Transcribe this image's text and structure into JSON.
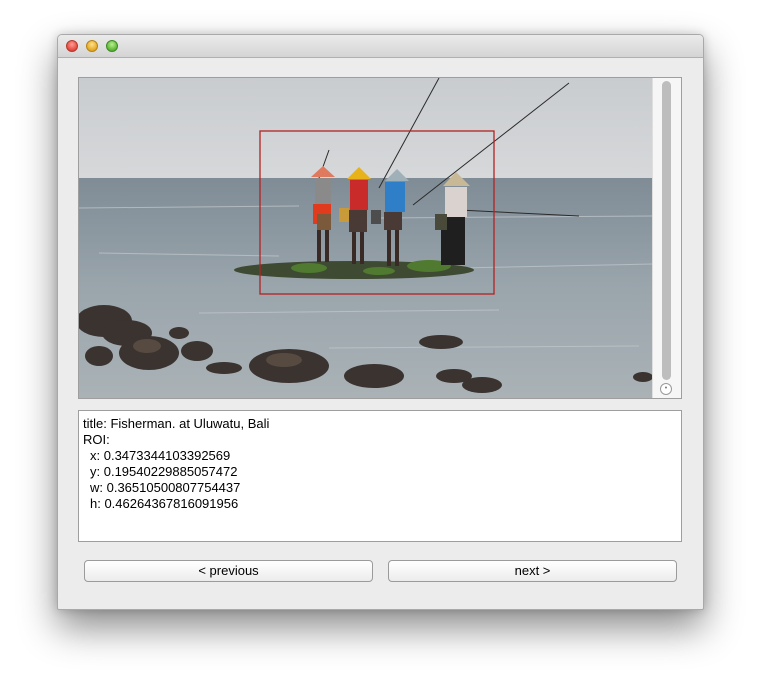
{
  "window": {
    "controls": [
      "close",
      "minimize",
      "maximize"
    ]
  },
  "image": {
    "scene": "fishermen standing on rocks at sea",
    "roi_color": "#b22222"
  },
  "info": {
    "title_line": "title: Fisherman. at Uluwatu, Bali",
    "roi_label": "ROI:",
    "x_line": "x: 0.3473344103392569",
    "y_line": "y: 0.19540229885057472",
    "w_line": "w: 0.36510500807754437",
    "h_line": "h: 0.46264367816091956"
  },
  "buttons": {
    "previous": "< previous",
    "next": "next >"
  }
}
